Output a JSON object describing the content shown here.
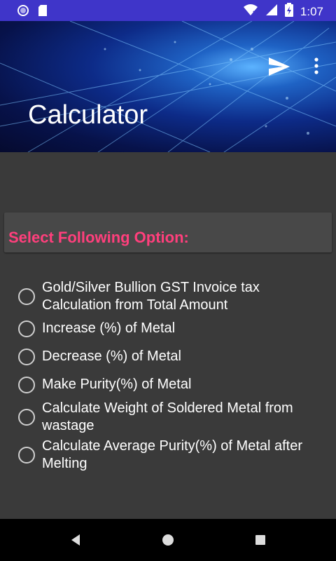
{
  "status_bar": {
    "time": "1:07",
    "icons": [
      "circle-icon",
      "sd-card-icon",
      "wifi-icon",
      "signal-icon",
      "battery-icon"
    ]
  },
  "header": {
    "title": "Calculator",
    "actions": [
      "send-icon",
      "more-vert-icon"
    ]
  },
  "section": {
    "heading": "Select Following Option:",
    "heading_color": "#ff3f7c"
  },
  "options": [
    {
      "label_line1": "Gold/Silver Bullion GST Invoice tax",
      "label_line2": "Calculation from Total Amount"
    },
    {
      "label_line1": "Increase (%) of Metal",
      "label_line2": ""
    },
    {
      "label_line1": "Decrease (%) of Metal",
      "label_line2": ""
    },
    {
      "label_line1": "Make Purity(%) of Metal",
      "label_line2": ""
    },
    {
      "label_line1": "Calculate Weight of Soldered Metal from",
      "label_line2": "wastage"
    },
    {
      "label_line1": "Calculate Average Purity(%) of Metal after",
      "label_line2": "Melting"
    }
  ],
  "nav": [
    "back-icon",
    "home-icon",
    "recents-icon"
  ],
  "colors": {
    "status_bar": "#3f35c9",
    "background": "#3a3a3a",
    "header_card": "#484848"
  }
}
